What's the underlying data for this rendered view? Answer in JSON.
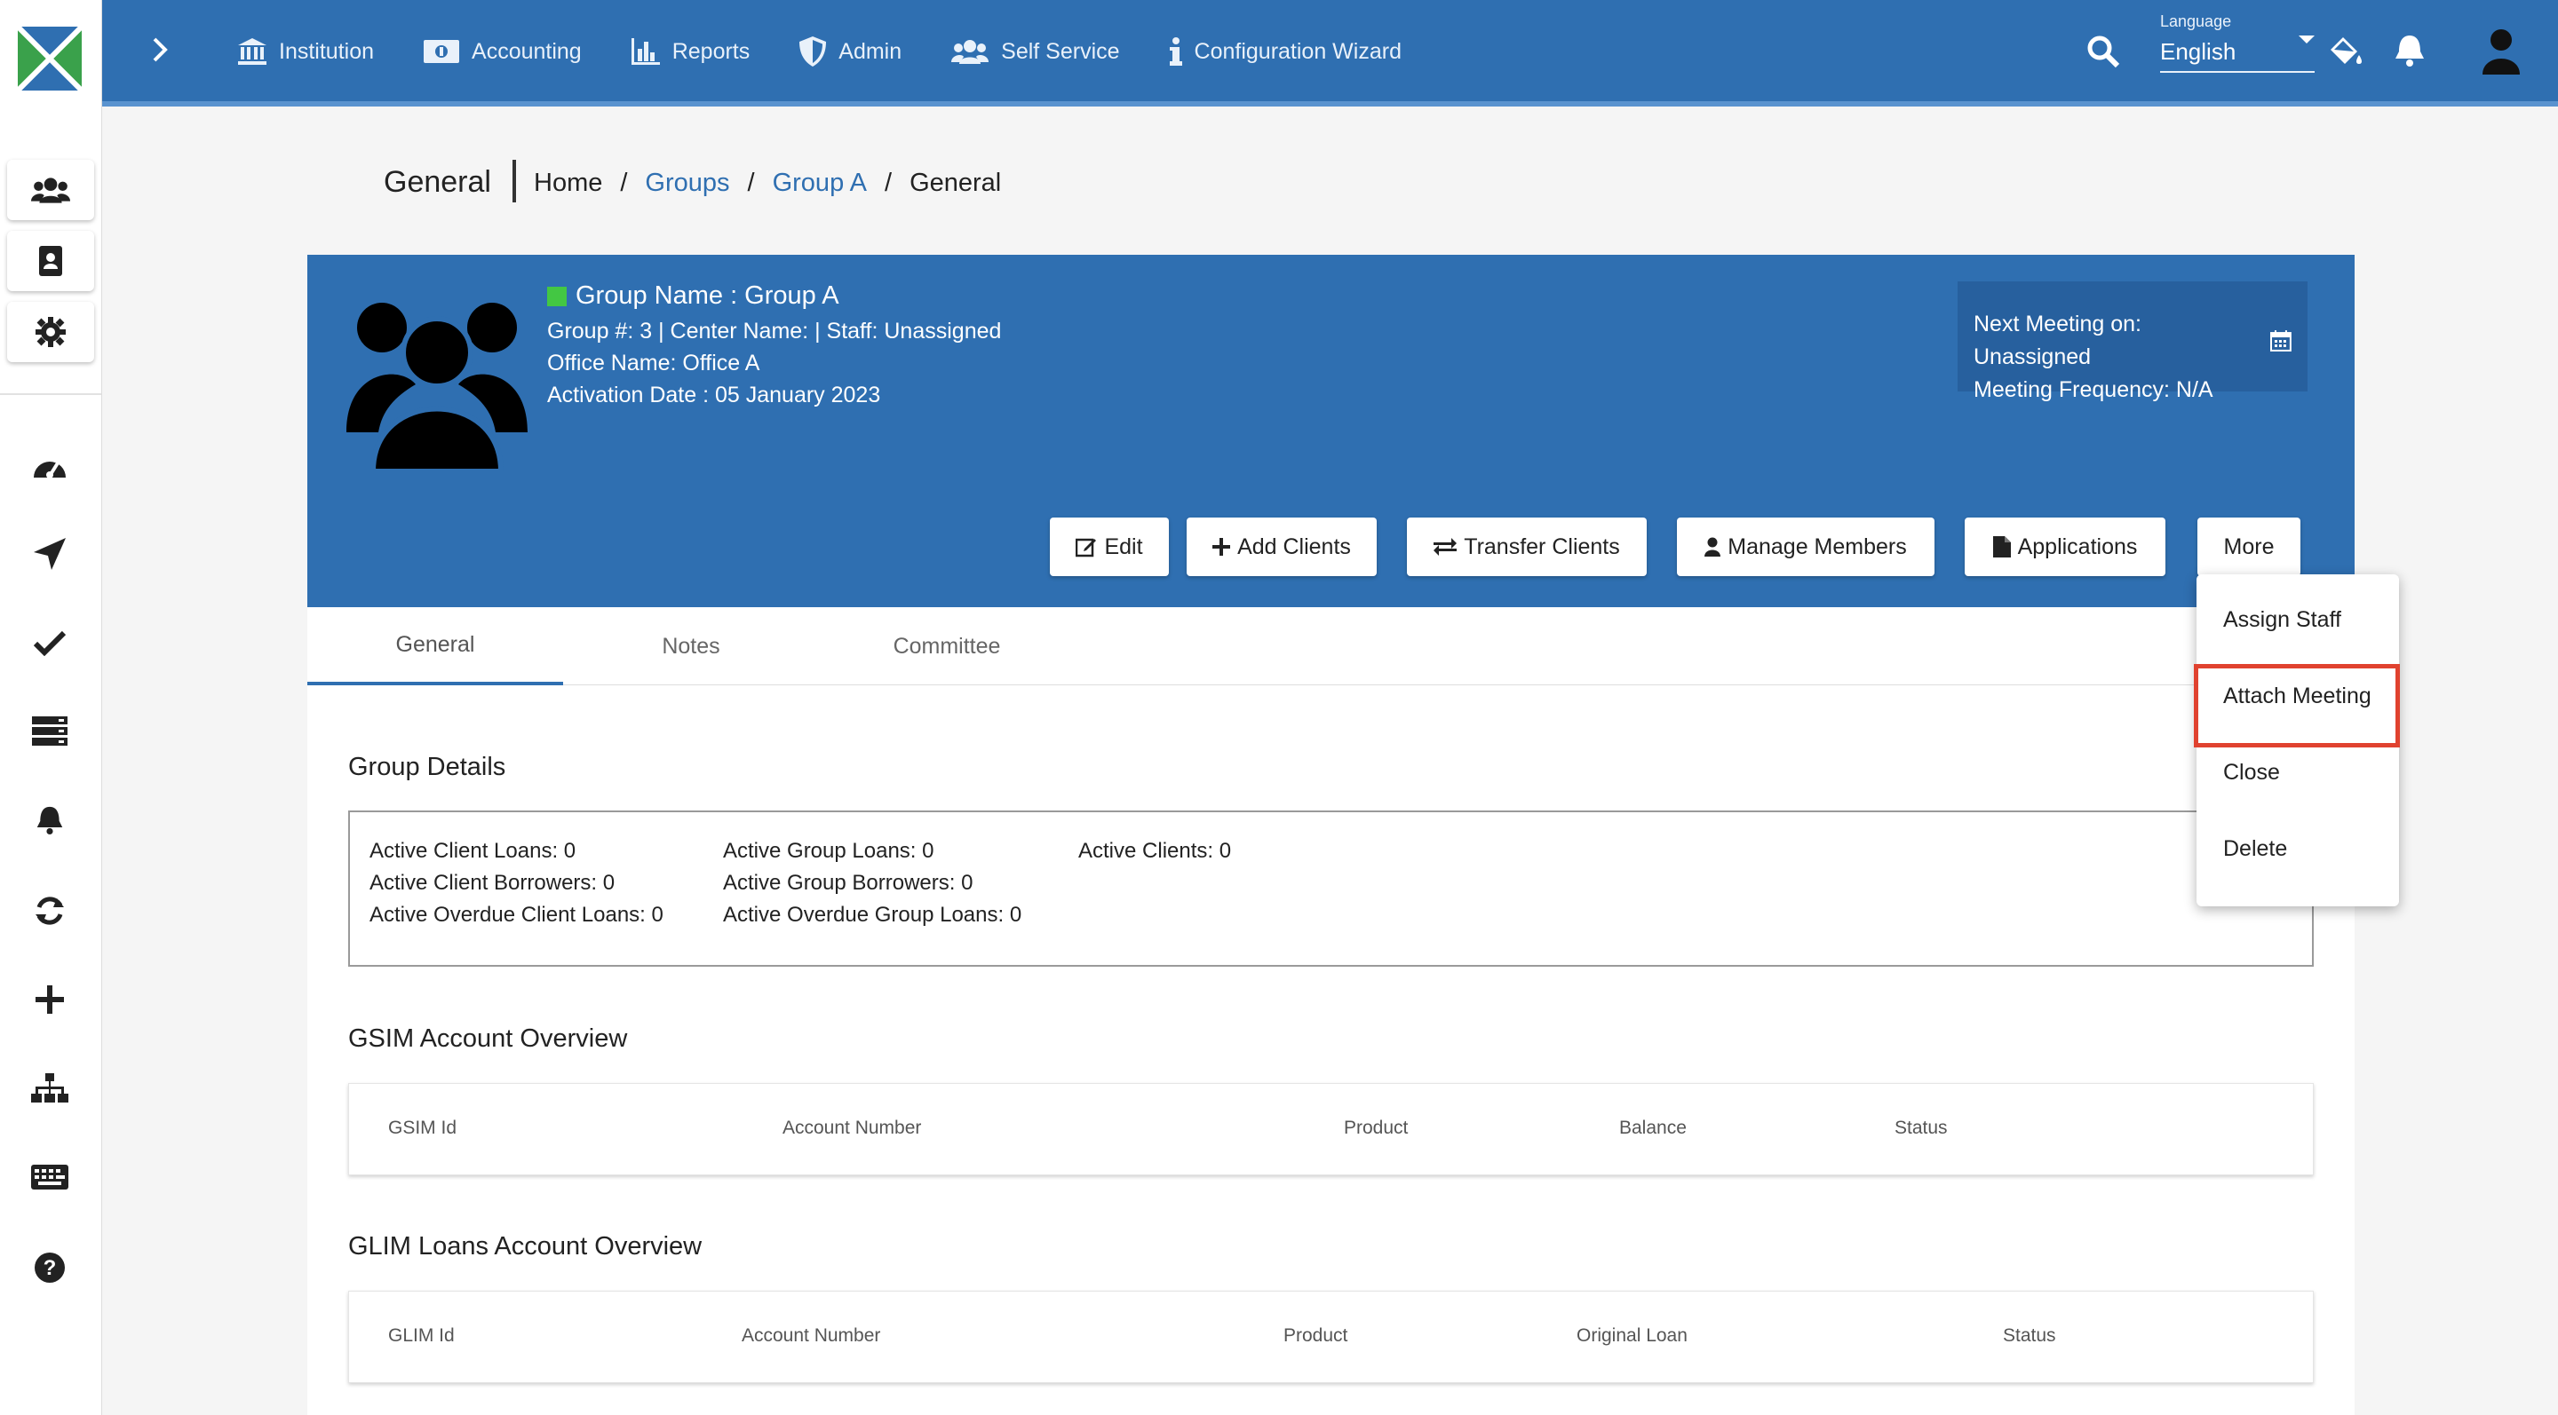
{
  "nav": {
    "items": [
      {
        "label": "Institution",
        "icon": "bank-icon"
      },
      {
        "label": "Accounting",
        "icon": "money-icon"
      },
      {
        "label": "Reports",
        "icon": "bar-chart-icon"
      },
      {
        "label": "Admin",
        "icon": "shield-icon"
      },
      {
        "label": "Self Service",
        "icon": "users-icon"
      },
      {
        "label": "Configuration Wizard",
        "icon": "info-icon"
      }
    ],
    "language_label": "Language",
    "language_value": "English"
  },
  "breadcrumb": {
    "title": "General",
    "items": [
      "Home",
      "Groups",
      "Group A",
      "General"
    ],
    "separator": "/"
  },
  "group": {
    "name": "Group Name : Group A",
    "line1": "Group #: 3 | Center Name: | Staff: Unassigned",
    "line2": "Office Name: Office A",
    "line3": "Activation Date : 05 January 2023",
    "next_meeting": "Next Meeting on: Unassigned",
    "meeting_frequency": "Meeting Frequency: N/A",
    "status_color": "#43c743"
  },
  "actions": {
    "edit": "Edit",
    "add_clients": "Add Clients",
    "transfer_clients": "Transfer Clients",
    "manage_members": "Manage Members",
    "applications": "Applications",
    "more": "More"
  },
  "tabs": [
    "General",
    "Notes",
    "Committee"
  ],
  "details": {
    "title": "Group Details",
    "col1": [
      "Active Client Loans: 0",
      "Active Client Borrowers: 0",
      "Active Overdue Client Loans: 0"
    ],
    "col2": [
      "Active Group Loans: 0",
      "Active Group Borrowers: 0",
      "Active Overdue Group Loans: 0"
    ],
    "col3": [
      "Active Clients: 0"
    ]
  },
  "gsim": {
    "title": "GSIM Account Overview",
    "headers": [
      "GSIM Id",
      "Account Number",
      "Product",
      "Balance",
      "Status"
    ]
  },
  "glim": {
    "title": "GLIM Loans Account Overview",
    "headers": [
      "GLIM Id",
      "Account Number",
      "Product",
      "Original Loan",
      "Status"
    ]
  },
  "more_menu": {
    "items": [
      "Assign Staff",
      "Attach Meeting",
      "Close",
      "Delete"
    ],
    "highlighted": "Attach Meeting",
    "highlight_color": "#e0422f"
  },
  "colors": {
    "primary": "#2f6fb1",
    "panel_dark": "#27609e"
  }
}
